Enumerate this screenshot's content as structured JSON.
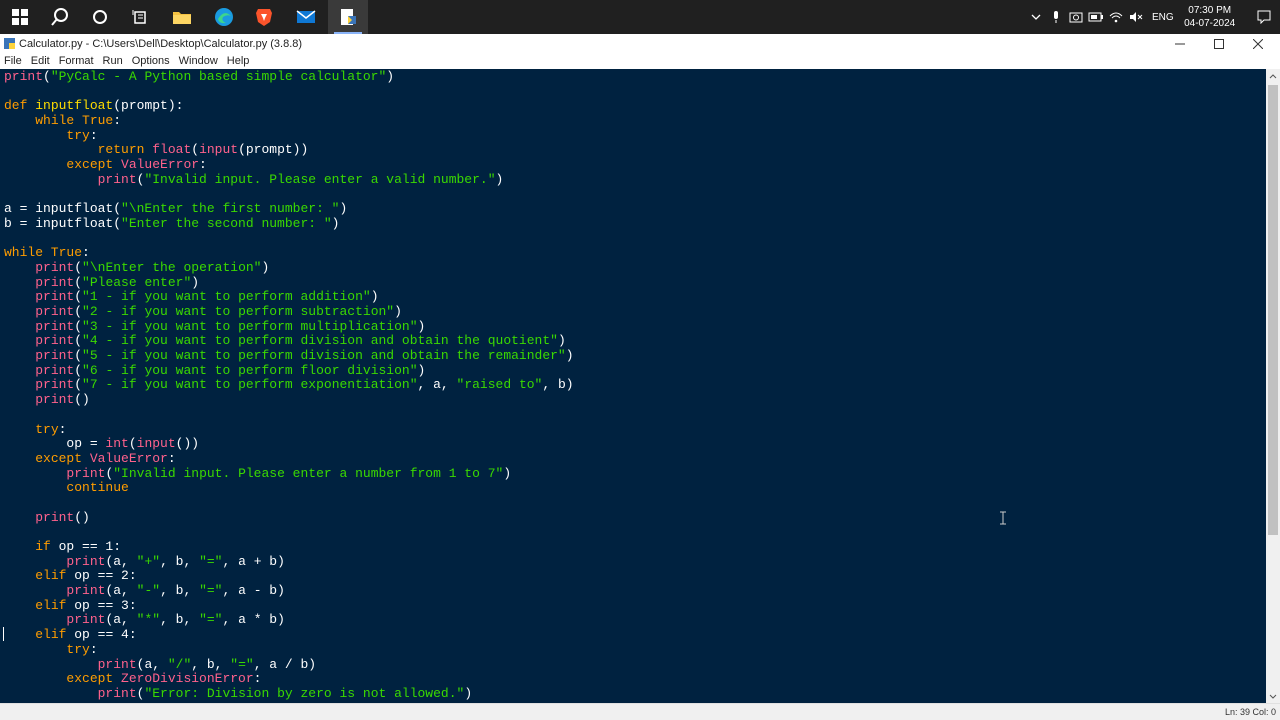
{
  "taskbar": {
    "apps": [
      {
        "name": "start",
        "icon": "windows-logo-icon"
      },
      {
        "name": "search",
        "icon": "search-icon"
      },
      {
        "name": "task-view",
        "icon": "task-view-icon"
      },
      {
        "name": "widgets",
        "icon": "widgets-icon"
      },
      {
        "name": "file-explorer",
        "icon": "folder-icon"
      },
      {
        "name": "edge",
        "icon": "edge-icon"
      },
      {
        "name": "brave",
        "icon": "brave-icon"
      },
      {
        "name": "mail",
        "icon": "mail-icon"
      },
      {
        "name": "idle",
        "icon": "idle-icon"
      }
    ],
    "language": "ENG",
    "time": "07:30 PM",
    "date": "04-07-2024"
  },
  "window": {
    "title": "Calculator.py - C:\\Users\\Dell\\Desktop\\Calculator.py (3.8.8)",
    "minimize": "—",
    "maximize": "☐",
    "close": "✕"
  },
  "menu": [
    "File",
    "Edit",
    "Format",
    "Run",
    "Options",
    "Window",
    "Help"
  ],
  "status": {
    "position": "Ln: 39   Col: 0"
  },
  "colors": {
    "editor_bg": "#002240",
    "keyword": "#ff9d00",
    "builtin": "#ff628c",
    "string": "#3ad900",
    "definition": "#ffdd00"
  },
  "code_lines": [
    [
      [
        "bi",
        "print"
      ],
      [
        "",
        "("
      ],
      [
        "st",
        "\"PyCalc - A Python based simple calculator\""
      ],
      [
        "",
        ")"
      ]
    ],
    [],
    [
      [
        "kw",
        "def "
      ],
      [
        "df",
        "inputfloat"
      ],
      [
        "",
        "(prompt):"
      ]
    ],
    [
      [
        "",
        "    "
      ],
      [
        "kw",
        "while True"
      ],
      [
        "",
        ":"
      ]
    ],
    [
      [
        "",
        "        "
      ],
      [
        "kw",
        "try"
      ],
      [
        "",
        ":"
      ]
    ],
    [
      [
        "",
        "            "
      ],
      [
        "kw",
        "return "
      ],
      [
        "bi",
        "float"
      ],
      [
        "",
        "("
      ],
      [
        "bi",
        "input"
      ],
      [
        "",
        "(prompt))"
      ]
    ],
    [
      [
        "",
        "        "
      ],
      [
        "kw",
        "except "
      ],
      [
        "ex",
        "ValueError"
      ],
      [
        "",
        ":"
      ]
    ],
    [
      [
        "",
        "            "
      ],
      [
        "bi",
        "print"
      ],
      [
        "",
        "("
      ],
      [
        "st",
        "\"Invalid input. Please enter a valid number.\""
      ],
      [
        "",
        ")"
      ]
    ],
    [],
    [
      [
        "",
        "a = inputfloat("
      ],
      [
        "st",
        "\"\\nEnter the first number: \""
      ],
      [
        "",
        ")"
      ]
    ],
    [
      [
        "",
        "b = inputfloat("
      ],
      [
        "st",
        "\"Enter the second number: \""
      ],
      [
        "",
        ")"
      ]
    ],
    [],
    [
      [
        "kw",
        "while True"
      ],
      [
        "",
        ":"
      ]
    ],
    [
      [
        "",
        "    "
      ],
      [
        "bi",
        "print"
      ],
      [
        "",
        "("
      ],
      [
        "st",
        "\"\\nEnter the operation\""
      ],
      [
        "",
        ")"
      ]
    ],
    [
      [
        "",
        "    "
      ],
      [
        "bi",
        "print"
      ],
      [
        "",
        "("
      ],
      [
        "st",
        "\"Please enter\""
      ],
      [
        "",
        ")"
      ]
    ],
    [
      [
        "",
        "    "
      ],
      [
        "bi",
        "print"
      ],
      [
        "",
        "("
      ],
      [
        "st",
        "\"1 - if you want to perform addition\""
      ],
      [
        "",
        ")"
      ]
    ],
    [
      [
        "",
        "    "
      ],
      [
        "bi",
        "print"
      ],
      [
        "",
        "("
      ],
      [
        "st",
        "\"2 - if you want to perform subtraction\""
      ],
      [
        "",
        ")"
      ]
    ],
    [
      [
        "",
        "    "
      ],
      [
        "bi",
        "print"
      ],
      [
        "",
        "("
      ],
      [
        "st",
        "\"3 - if you want to perform multiplication\""
      ],
      [
        "",
        ")"
      ]
    ],
    [
      [
        "",
        "    "
      ],
      [
        "bi",
        "print"
      ],
      [
        "",
        "("
      ],
      [
        "st",
        "\"4 - if you want to perform division and obtain the quotient\""
      ],
      [
        "",
        ")"
      ]
    ],
    [
      [
        "",
        "    "
      ],
      [
        "bi",
        "print"
      ],
      [
        "",
        "("
      ],
      [
        "st",
        "\"5 - if you want to perform division and obtain the remainder\""
      ],
      [
        "",
        ")"
      ]
    ],
    [
      [
        "",
        "    "
      ],
      [
        "bi",
        "print"
      ],
      [
        "",
        "("
      ],
      [
        "st",
        "\"6 - if you want to perform floor division\""
      ],
      [
        "",
        ")"
      ]
    ],
    [
      [
        "",
        "    "
      ],
      [
        "bi",
        "print"
      ],
      [
        "",
        "("
      ],
      [
        "st",
        "\"7 - if you want to perform exponentiation\""
      ],
      [
        "",
        ", a, "
      ],
      [
        "st",
        "\"raised to\""
      ],
      [
        "",
        ", b)"
      ]
    ],
    [
      [
        "",
        "    "
      ],
      [
        "bi",
        "print"
      ],
      [
        "",
        "()"
      ]
    ],
    [],
    [
      [
        "",
        "    "
      ],
      [
        "kw",
        "try"
      ],
      [
        "",
        ":"
      ]
    ],
    [
      [
        "",
        "        op = "
      ],
      [
        "bi",
        "int"
      ],
      [
        "",
        "("
      ],
      [
        "bi",
        "input"
      ],
      [
        "",
        "())"
      ]
    ],
    [
      [
        "",
        "    "
      ],
      [
        "kw",
        "except "
      ],
      [
        "ex",
        "ValueError"
      ],
      [
        "",
        ":"
      ]
    ],
    [
      [
        "",
        "        "
      ],
      [
        "bi",
        "print"
      ],
      [
        "",
        "("
      ],
      [
        "st",
        "\"Invalid input. Please enter a number from 1 to 7\""
      ],
      [
        "",
        ")"
      ]
    ],
    [
      [
        "",
        "        "
      ],
      [
        "kw",
        "continue"
      ]
    ],
    [],
    [
      [
        "",
        "    "
      ],
      [
        "bi",
        "print"
      ],
      [
        "",
        "()"
      ]
    ],
    [],
    [
      [
        "",
        "    "
      ],
      [
        "kw",
        "if "
      ],
      [
        "",
        "op == 1:"
      ]
    ],
    [
      [
        "",
        "        "
      ],
      [
        "bi",
        "print"
      ],
      [
        "",
        "(a, "
      ],
      [
        "st",
        "\"+\""
      ],
      [
        "",
        ", b, "
      ],
      [
        "st",
        "\"=\""
      ],
      [
        "",
        ", a + b)"
      ]
    ],
    [
      [
        "",
        "    "
      ],
      [
        "kw",
        "elif "
      ],
      [
        "",
        "op == 2:"
      ]
    ],
    [
      [
        "",
        "        "
      ],
      [
        "bi",
        "print"
      ],
      [
        "",
        "(a, "
      ],
      [
        "st",
        "\"-\""
      ],
      [
        "",
        ", b, "
      ],
      [
        "st",
        "\"=\""
      ],
      [
        "",
        ", a - b)"
      ]
    ],
    [
      [
        "",
        "    "
      ],
      [
        "kw",
        "elif "
      ],
      [
        "",
        "op == 3:"
      ]
    ],
    [
      [
        "",
        "        "
      ],
      [
        "bi",
        "print"
      ],
      [
        "",
        "(a, "
      ],
      [
        "st",
        "\"*\""
      ],
      [
        "",
        ", b, "
      ],
      [
        "st",
        "\"=\""
      ],
      [
        "",
        ", a * b)"
      ]
    ],
    [
      [
        "",
        "    "
      ],
      [
        "kw",
        "elif "
      ],
      [
        "",
        "op == 4:"
      ]
    ],
    [
      [
        "",
        "        "
      ],
      [
        "kw",
        "try"
      ],
      [
        "",
        ":"
      ]
    ],
    [
      [
        "",
        "            "
      ],
      [
        "bi",
        "print"
      ],
      [
        "",
        "(a, "
      ],
      [
        "st",
        "\"/\""
      ],
      [
        "",
        ", b, "
      ],
      [
        "st",
        "\"=\""
      ],
      [
        "",
        ", a / b)"
      ]
    ],
    [
      [
        "",
        "        "
      ],
      [
        "kw",
        "except "
      ],
      [
        "ex",
        "ZeroDivisionError"
      ],
      [
        "",
        ":"
      ]
    ],
    [
      [
        "",
        "            "
      ],
      [
        "bi",
        "print"
      ],
      [
        "",
        "("
      ],
      [
        "st",
        "\"Error: Division by zero is not allowed.\""
      ],
      [
        "",
        ")"
      ]
    ]
  ]
}
